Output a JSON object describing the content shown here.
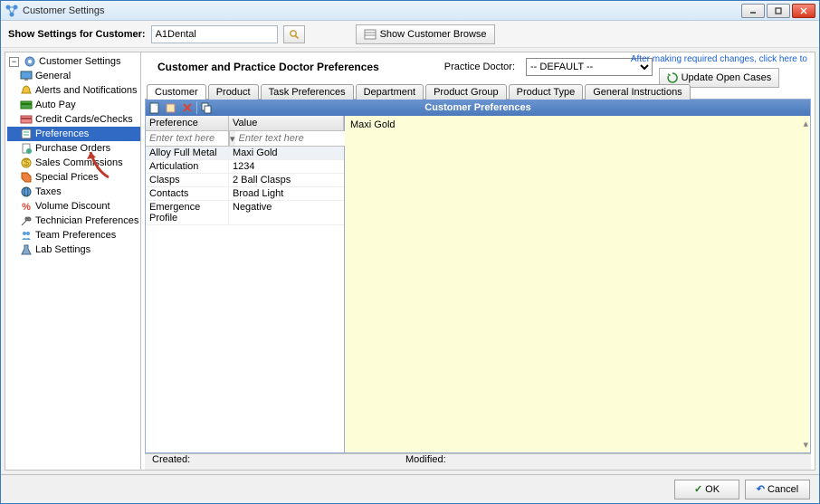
{
  "window": {
    "title": "Customer Settings"
  },
  "toolbar": {
    "show_label": "Show Settings for Customer:",
    "customer_value": "A1Dental",
    "browse_label": "Show Customer Browse"
  },
  "sidebar": {
    "root": "Customer Settings",
    "items": [
      {
        "label": "General",
        "icon": "monitor"
      },
      {
        "label": "Alerts and Notifications",
        "icon": "bell"
      },
      {
        "label": "Auto Pay",
        "icon": "card"
      },
      {
        "label": "Credit Cards/eChecks",
        "icon": "card2"
      },
      {
        "label": "Preferences",
        "icon": "pref",
        "selected": true
      },
      {
        "label": "Purchase Orders",
        "icon": "po"
      },
      {
        "label": "Sales Commissions",
        "icon": "money"
      },
      {
        "label": "Special Prices",
        "icon": "tag"
      },
      {
        "label": "Taxes",
        "icon": "globe"
      },
      {
        "label": "Volume Discount",
        "icon": "percent"
      },
      {
        "label": "Technician Preferences",
        "icon": "wrench"
      },
      {
        "label": "Team Preferences",
        "icon": "team"
      },
      {
        "label": "Lab Settings",
        "icon": "lab"
      }
    ]
  },
  "content": {
    "heading": "Customer and Practice Doctor Preferences",
    "practice_doctor_label": "Practice Doctor:",
    "practice_doctor_value": "-- DEFAULT --",
    "hint": "After making required changes, click here to",
    "update_button": "Update Open Cases",
    "tabs": [
      "Customer",
      "Product",
      "Task Preferences",
      "Department",
      "Product Group",
      "Product Type",
      "General Instructions"
    ],
    "active_tab": 0,
    "blue_header": "Customer Preferences",
    "table": {
      "col1": "Preference",
      "col2": "Value",
      "filter_placeholder": "Enter text here",
      "rows": [
        {
          "pref": "Alloy Full Metal",
          "val": "Maxi Gold",
          "selected": true
        },
        {
          "pref": "Articulation",
          "val": "1234"
        },
        {
          "pref": "Clasps",
          "val": "2 Ball Clasps"
        },
        {
          "pref": "Contacts",
          "val": "Broad Light"
        },
        {
          "pref": "Emergence Profile",
          "val": "Negative"
        }
      ]
    },
    "detail_text": "Maxi Gold",
    "status_created": "Created:",
    "status_modified": "Modified:"
  },
  "buttons": {
    "ok": "OK",
    "cancel": "Cancel"
  }
}
